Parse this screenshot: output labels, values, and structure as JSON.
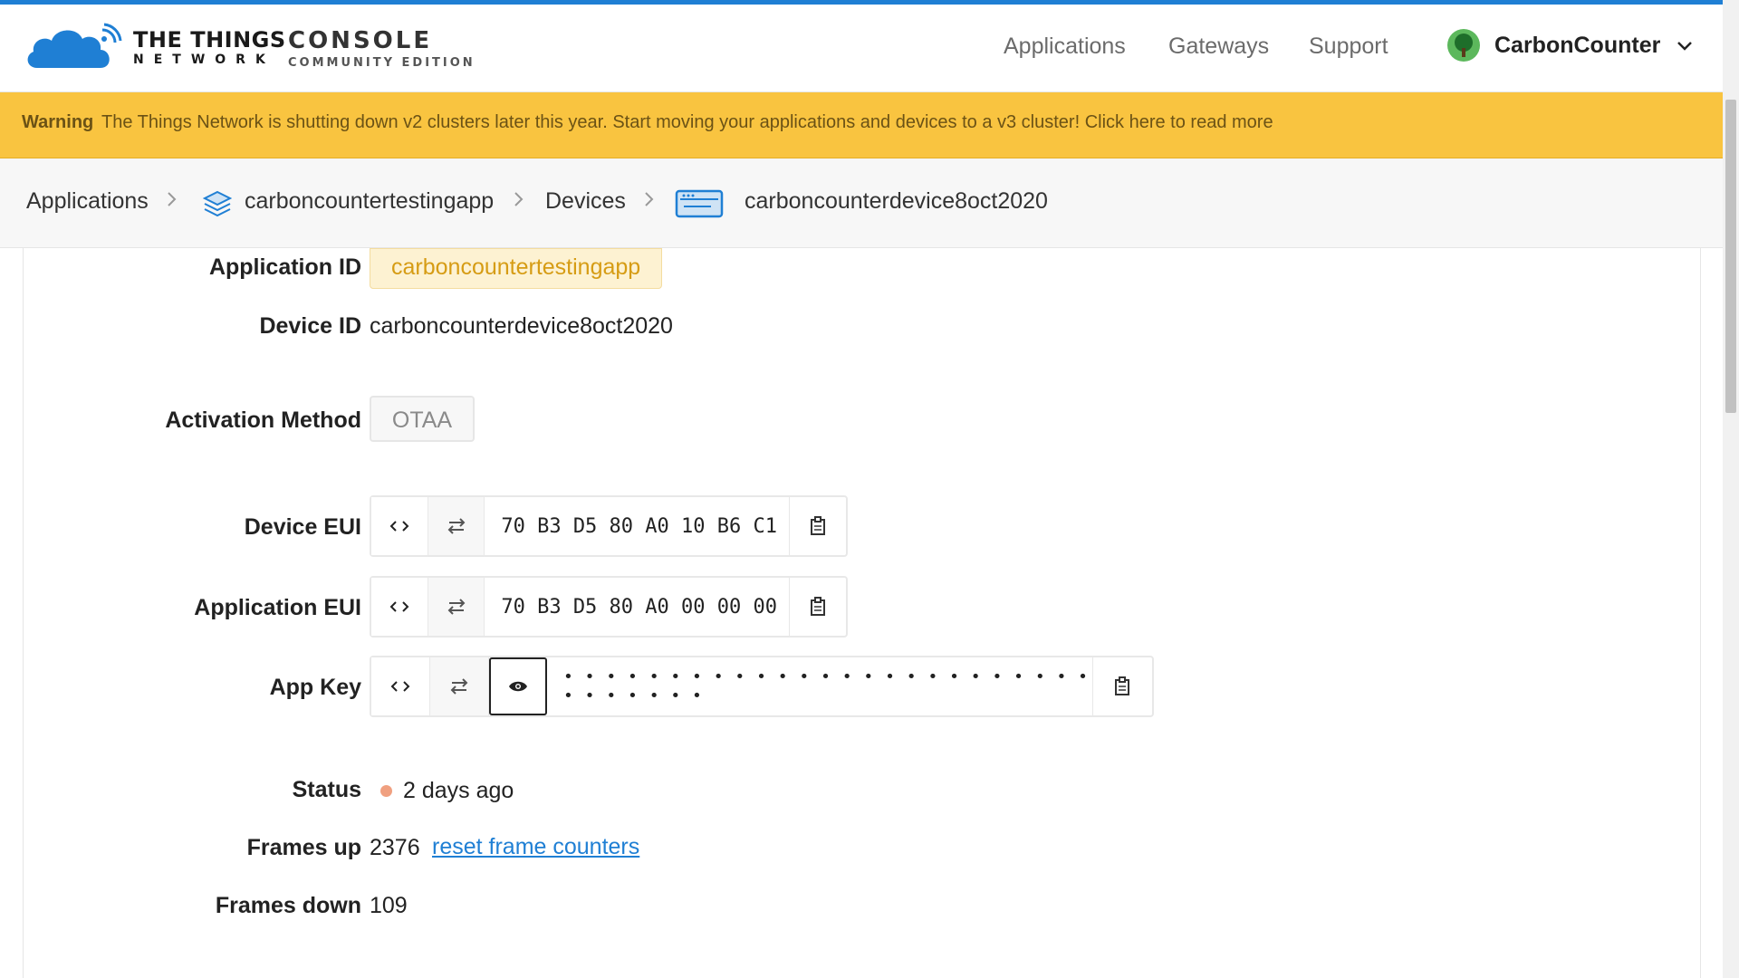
{
  "brand": {
    "line1": "THE THINGS",
    "line2": "NETWORK",
    "console": "CONSOLE",
    "edition": "COMMUNITY EDITION"
  },
  "nav": {
    "applications": "Applications",
    "gateways": "Gateways",
    "support": "Support"
  },
  "user": {
    "name": "CarbonCounter"
  },
  "warning": {
    "label": "Warning",
    "text": "The Things Network is shutting down v2 clusters later this year. Start moving your applications and devices to a v3 cluster! Click here to read more"
  },
  "breadcrumb": {
    "applications": "Applications",
    "app": "carboncountertestingapp",
    "devices": "Devices",
    "device": "carboncounterdevice8oct2020"
  },
  "device": {
    "application_id_label": "Application ID",
    "application_id": "carboncountertestingapp",
    "device_id_label": "Device ID",
    "device_id": "carboncounterdevice8oct2020",
    "activation_label": "Activation Method",
    "activation": "OTAA",
    "device_eui_label": "Device EUI",
    "device_eui": "70 B3 D5 80 A0 10 B6 C1",
    "app_eui_label": "Application EUI",
    "app_eui": "70 B3 D5 80 A0 00 00 00",
    "app_key_label": "App Key",
    "app_key": "• • • • • • • • • • • • • • • • • • • • • • • • • • • • • • • •",
    "status_label": "Status",
    "status": "2 days ago",
    "frames_up_label": "Frames up",
    "frames_up": "2376",
    "reset_link": "reset frame counters",
    "frames_down_label": "Frames down",
    "frames_down": "109"
  },
  "colors": {
    "accent": "#1f7fd4",
    "warning_bg": "#f9c440",
    "status_dot": "#f0a080"
  }
}
